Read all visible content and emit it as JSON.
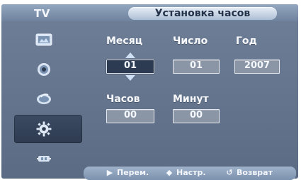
{
  "header": {
    "app_label": "TV",
    "title": "Установка часов"
  },
  "sidebar": {
    "items": [
      {
        "icon": "picture-icon",
        "active": false
      },
      {
        "icon": "sound-icon",
        "active": false
      },
      {
        "icon": "channel-icon",
        "active": false
      },
      {
        "icon": "settings-gear-icon",
        "active": true
      },
      {
        "icon": "input-icon",
        "active": false
      }
    ]
  },
  "clock": {
    "labels": {
      "month": "Месяц",
      "day": "Число",
      "year": "Год",
      "hours": "Часов",
      "minutes": "Минут"
    },
    "values": {
      "month": "01",
      "day": "01",
      "year": "2007",
      "hours": "00",
      "minutes": "00"
    }
  },
  "footer": {
    "move": {
      "symbol": "▶",
      "label": "Перем."
    },
    "adjust": {
      "symbol": "◆",
      "label": "Настр."
    },
    "return": {
      "symbol": "↺",
      "label": "Возврат"
    }
  }
}
